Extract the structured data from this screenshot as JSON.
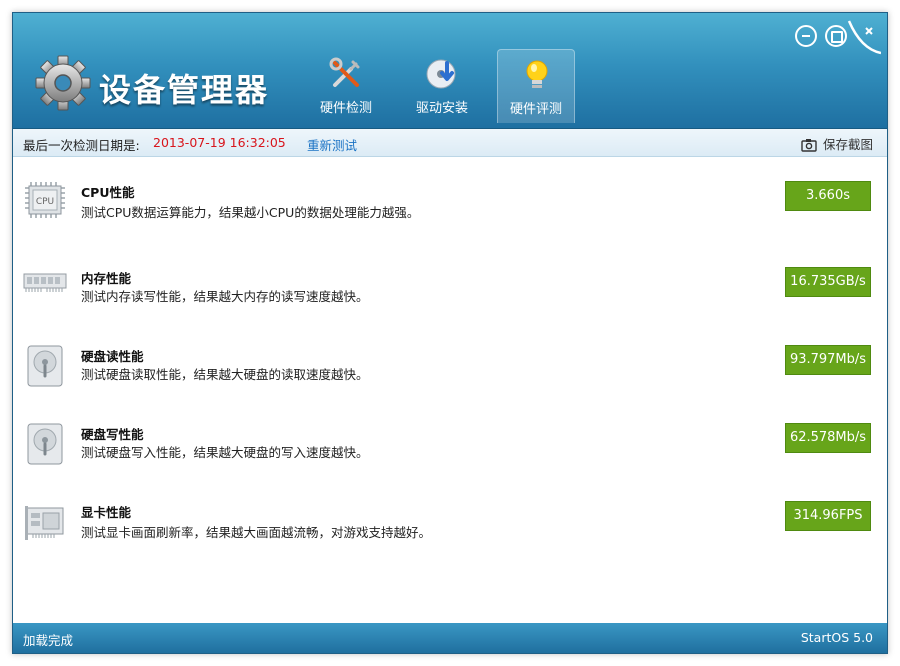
{
  "app": {
    "title": "设备管理器"
  },
  "tabs": [
    {
      "label": "硬件检测",
      "icon": "tools-icon",
      "active": false
    },
    {
      "label": "驱动安装",
      "icon": "driver-disc-icon",
      "active": false
    },
    {
      "label": "硬件评测",
      "icon": "lightbulb-icon",
      "active": true
    }
  ],
  "infobar": {
    "label": "最后一次检测日期是:",
    "date": "2013-07-19 16:32:05",
    "retest": "重新测试",
    "save_screenshot": "保存截图"
  },
  "benchmarks": [
    {
      "title": "CPU性能",
      "desc": "测试CPU数据运算能力，结果越小CPU的数据处理能力越强。",
      "score": "3.660s",
      "icon": "cpu-icon",
      "chip_text": "CPU"
    },
    {
      "title": "内存性能",
      "desc": "测试内存读写性能，结果越大内存的读写速度越快。",
      "score": "16.735GB/s",
      "icon": "memory-icon"
    },
    {
      "title": "硬盘读性能",
      "desc": "测试硬盘读取性能，结果越大硬盘的读取速度越快。",
      "score": "93.797Mb/s",
      "icon": "harddisk-icon"
    },
    {
      "title": "硬盘写性能",
      "desc": "测试硬盘写入性能，结果越大硬盘的写入速度越快。",
      "score": "62.578Mb/s",
      "icon": "harddisk-icon"
    },
    {
      "title": "显卡性能",
      "desc": "测试显卡画面刷新率，结果越大画面越流畅，对游戏支持越好。",
      "score": "314.96FPS",
      "icon": "graphics-card-icon"
    }
  ],
  "status": {
    "left": "加载完成",
    "right": "StartOS 5.0"
  },
  "colors": {
    "score_bg": "#67a51a",
    "date_red": "#d8141b",
    "link_blue": "#1a72c4",
    "header_blue": "#3290bd"
  }
}
